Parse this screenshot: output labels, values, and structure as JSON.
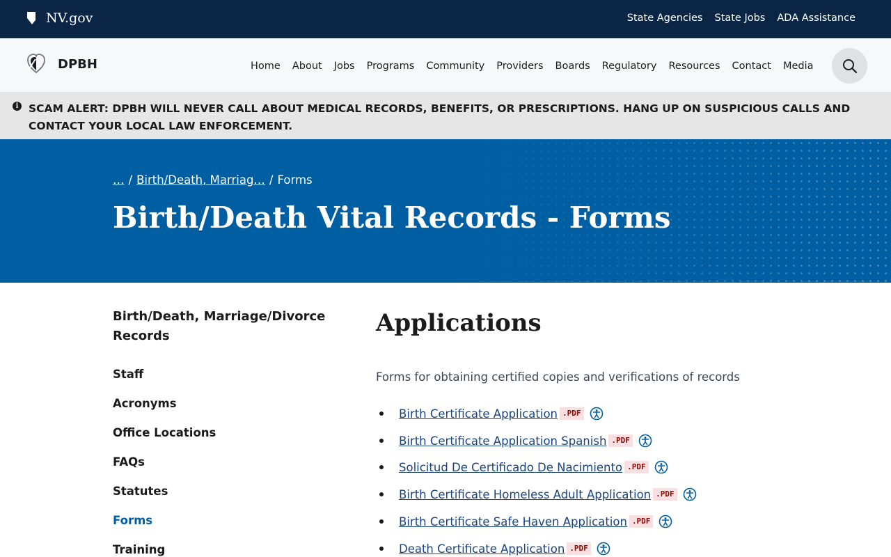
{
  "top_bar": {
    "site_name": "NV.gov",
    "links": [
      "State Agencies",
      "State Jobs",
      "ADA Assistance"
    ]
  },
  "header": {
    "logo_text": "DPBH",
    "nav": [
      "Home",
      "About",
      "Jobs",
      "Programs",
      "Community",
      "Providers",
      "Boards",
      "Regulatory",
      "Resources",
      "Contact",
      "Media"
    ],
    "search_icon": "search-icon"
  },
  "alert": {
    "icon": "info-icon",
    "text": "SCAM ALERT: DPBH WILL NEVER CALL ABOUT MEDICAL RECORDS, BENEFITS, OR PRESCRIPTIONS. HANG UP ON SUSPICIOUS CALLS AND CONTACT YOUR LOCAL LAW ENFORCEMENT."
  },
  "hero": {
    "breadcrumb": [
      "…",
      "Birth/Death, Marriag…",
      "Forms"
    ],
    "title": "Birth/Death Vital Records - Forms",
    "background_color": "#005ea2"
  },
  "sidebar": {
    "title": "Birth/Death, Marriage/Divorce Records",
    "items": [
      "Staff",
      "Acronyms",
      "Office Locations",
      "FAQs",
      "Statutes",
      "Forms",
      "Training"
    ],
    "current": "Forms"
  },
  "main": {
    "heading": "Applications",
    "intro": "Forms for obtaining certified copies and verifications of records",
    "pdf_label": ".PDF",
    "accessibility_icon": "accessibility-icon",
    "forms": [
      "Birth Certificate Application",
      "Birth Certificate Application Spanish",
      "Solicitud De Certificado De Nacimiento",
      "Birth Certificate Homeless Adult Application",
      "Birth Certificate Safe Haven Application",
      "Death Certificate Application"
    ]
  },
  "colors": {
    "top_bar": "#0b2545",
    "link": "#1a4480",
    "current_nav": "#005ea2",
    "pdf_badge_bg": "#f8dfe2",
    "pdf_badge_text": "#8b0a03"
  }
}
